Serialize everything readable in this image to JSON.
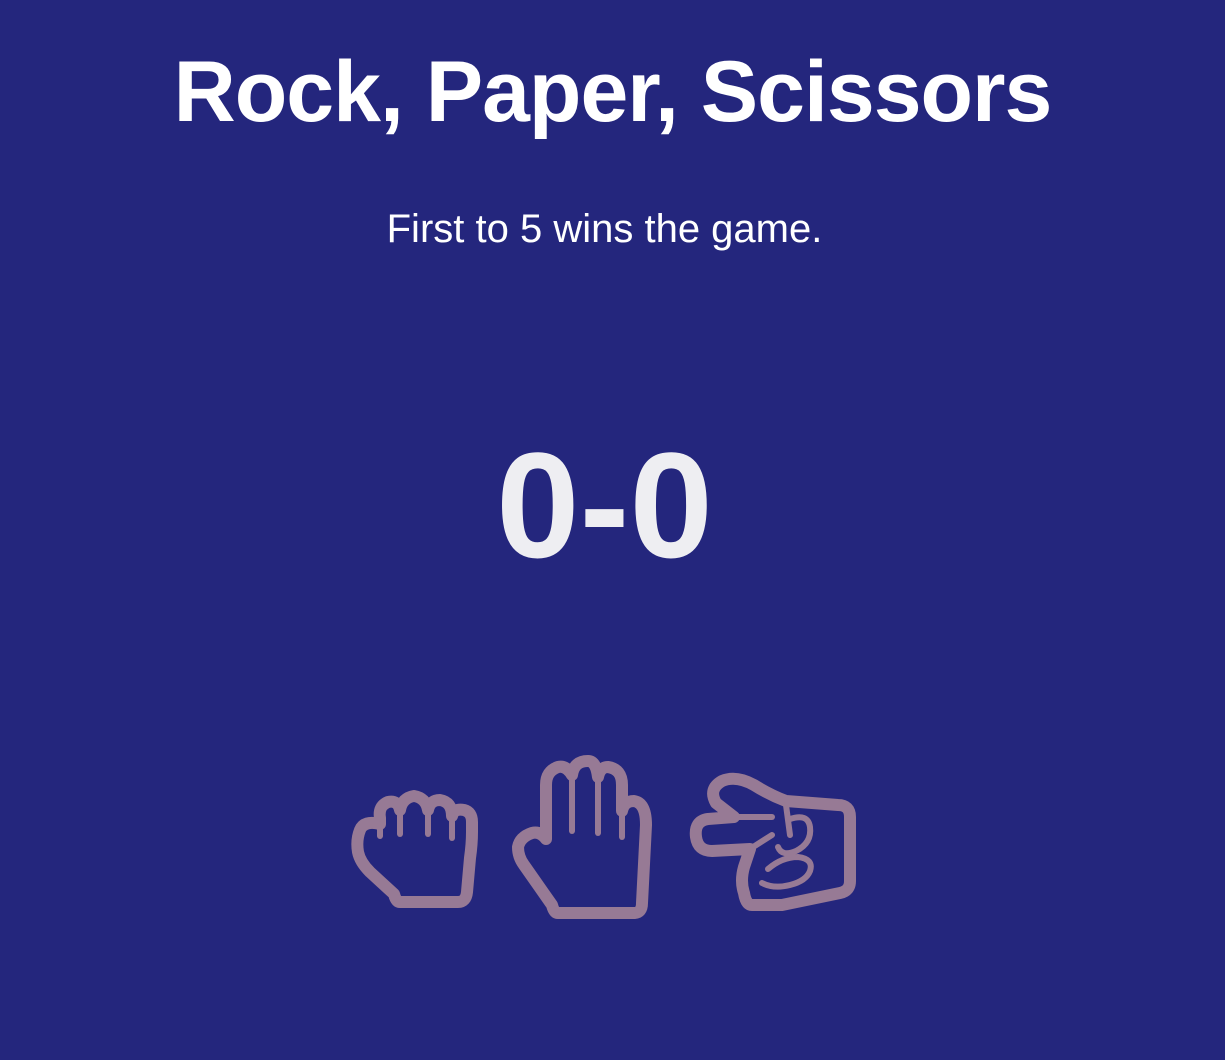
{
  "game": {
    "title": "Rock, Paper, Scissors",
    "subtitle": "First to 5 wins the game.",
    "score": "0-0"
  },
  "choices": [
    {
      "id": "rock",
      "icon": "rock-hand-icon"
    },
    {
      "id": "paper",
      "icon": "paper-hand-icon"
    },
    {
      "id": "scissors",
      "icon": "scissors-hand-icon"
    }
  ],
  "colors": {
    "background": "#24267d",
    "text": "#ffffff",
    "score": "#eeeef2",
    "icon_stroke": "#977a95"
  }
}
